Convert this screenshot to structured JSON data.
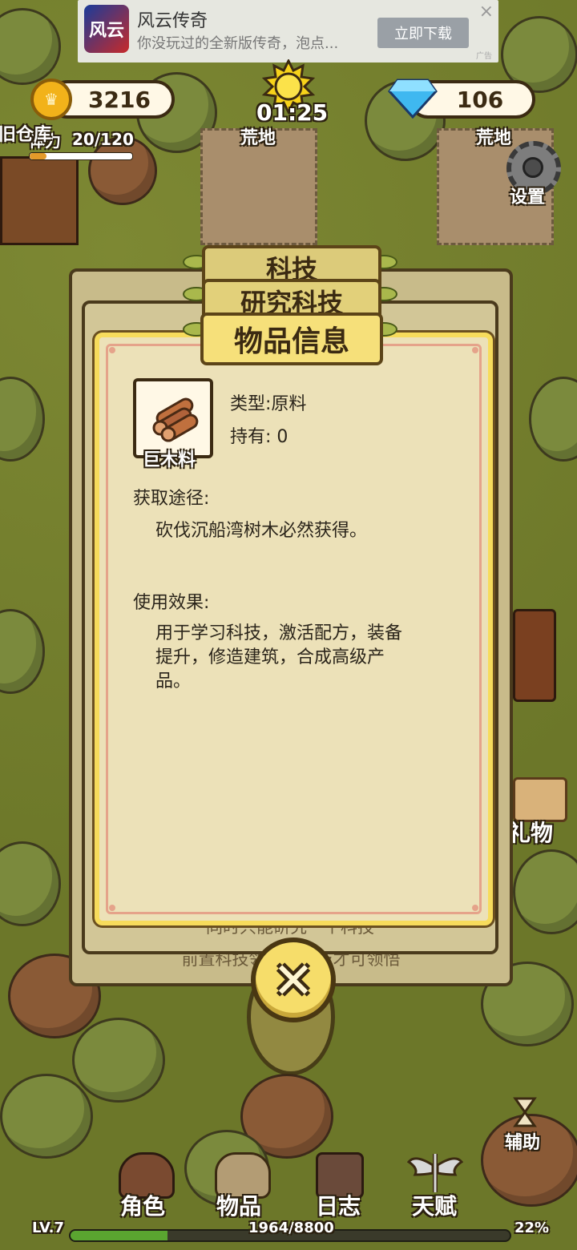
{
  "ad": {
    "icon_text": "风云",
    "title": "风云传奇",
    "subtitle": "你没玩过的全新版传奇，泡点...",
    "button": "立即下载",
    "close": "×",
    "tag": "广告"
  },
  "hud": {
    "gold": "3216",
    "gems": "106",
    "timer": "01:25",
    "stamina_label": "体力",
    "stamina_value": "20/120",
    "stamina_fraction": 0.1667,
    "settings_label": "设置",
    "map_label_left": "荒地",
    "map_label_right": "荒地",
    "warehouse_label": "旧仓库",
    "gift_label": "礼物",
    "assist_label": "辅助"
  },
  "panels": {
    "back_title": "科技",
    "middle_title": "研究科技",
    "front_title": "物品信息",
    "back_footer": "前置科技领悟后科技才可领悟",
    "middle_footer": "同时只能研究一个科技"
  },
  "item": {
    "name": "巨木料",
    "type_line": "类型:原料",
    "owned_line": "持有: 0",
    "source_heading": "获取途径:",
    "source_text": "砍伐沉船湾树木必然获得。",
    "effect_heading": "使用效果:",
    "effect_lines": [
      "用于学习科技，激活配方，装备",
      "提升，修造建筑，合成高级产",
      "品。"
    ]
  },
  "close_button": "✕",
  "nav": [
    {
      "label": "角色",
      "icon": "character-icon"
    },
    {
      "label": "物品",
      "icon": "bag-icon"
    },
    {
      "label": "日志",
      "icon": "journal-icon"
    },
    {
      "label": "天赋",
      "icon": "wings-sword-icon"
    }
  ],
  "level": {
    "label": "LV.7",
    "xp": "1964/8800",
    "percent": "22%",
    "fraction": 0.22
  },
  "colors": {
    "panel_bg": "#ece1b8",
    "banner": "#f2de7c",
    "ground": "#6c7729",
    "xp_fill": "#5aa530"
  }
}
